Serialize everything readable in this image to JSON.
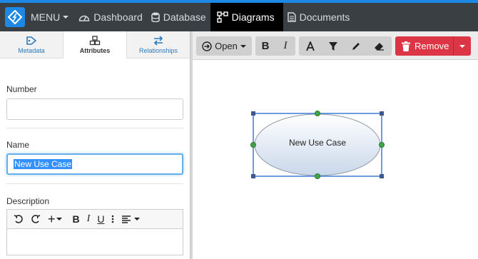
{
  "navbar": {
    "menu_label": "MENU",
    "dashboard_label": "Dashboard",
    "database_label": "Database",
    "diagrams_label": "Diagrams",
    "documents_label": "Documents"
  },
  "tabs": {
    "metadata": "Metadata",
    "attributes": "Attributes",
    "relationships": "Relationships"
  },
  "form": {
    "number_label": "Number",
    "number_value": "",
    "name_label": "Name",
    "name_value": "New Use Case",
    "description_label": "Description"
  },
  "toolbar": {
    "open_label": "Open",
    "bold_label": "B",
    "italic_label": "I",
    "remove_label": "Remove"
  },
  "diagram": {
    "shape_label": "New Use Case"
  },
  "colors": {
    "accent": "#1e88e5",
    "navbar": "#3a3f44",
    "remove": "#dc3545",
    "selection": "#3390ff"
  }
}
